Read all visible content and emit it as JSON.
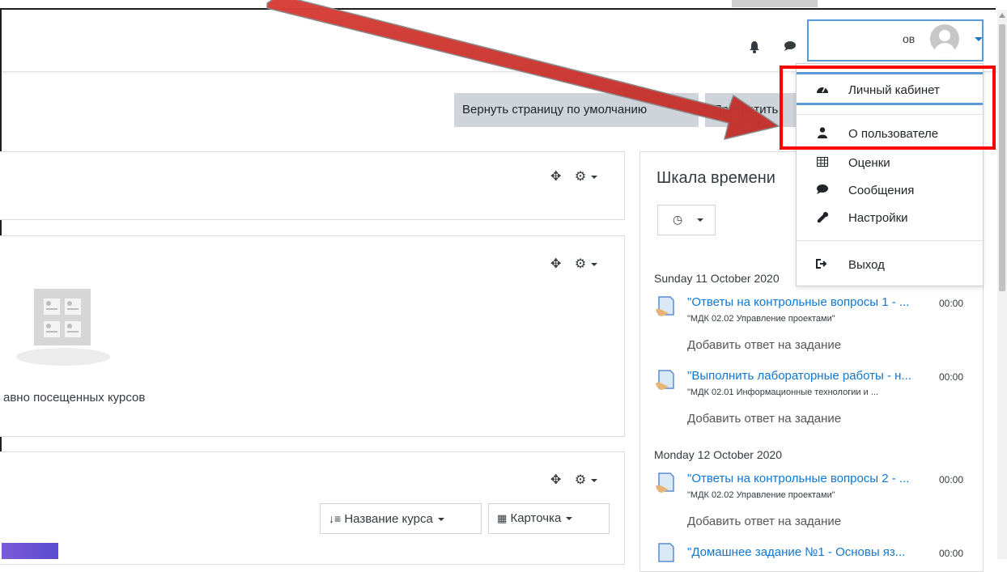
{
  "page_header": {
    "reset_button": "Вернуть страницу по умолчанию",
    "stop_button": "Прекратить"
  },
  "user_menu": {
    "user_name_partial": "ов",
    "items": [
      {
        "label": "Личный кабинет",
        "icon": "dashboard-icon"
      },
      {
        "label": "О пользователе",
        "icon": "user-icon"
      },
      {
        "label": "Оценки",
        "icon": "table-icon"
      },
      {
        "label": "Сообщения",
        "icon": "comment-icon"
      },
      {
        "label": "Настройки",
        "icon": "wrench-icon"
      },
      {
        "label": "Выход",
        "icon": "sign-out-icon"
      }
    ]
  },
  "recent_courses": {
    "empty_text": "авно посещенных курсов"
  },
  "course_overview": {
    "sort_label": "Название курса",
    "view_label": "Карточка"
  },
  "timeline": {
    "title": "Шкала времени",
    "groups": [
      {
        "date": "Sunday 11 October 2020",
        "events": [
          {
            "title": "\"Ответы на контрольные вопросы 1 - ...",
            "time": "00:00",
            "course": "\"МДК 02.02 Управление проектами\"",
            "action": "Добавить ответ на задание"
          },
          {
            "title": "\"Выполнить лабораторные работы - н...",
            "time": "00:00",
            "course": "\"МДК 02.01 Информационные технологии и ...",
            "action": "Добавить ответ на задание"
          }
        ]
      },
      {
        "date": "Monday 12 October 2020",
        "events": [
          {
            "title": "\"Ответы на контрольные вопросы 2 - ...",
            "time": "00:00",
            "course": "\"МДК 02.02 Управление проектами\"",
            "action": "Добавить ответ на задание"
          },
          {
            "title": "\"Домашнее задание №1 - Основы яз...",
            "time": "00:00"
          }
        ]
      }
    ]
  },
  "colors": {
    "annotation_red": "#ff0000",
    "link_blue": "#1177d1",
    "focus_blue": "#5b9bd5"
  }
}
